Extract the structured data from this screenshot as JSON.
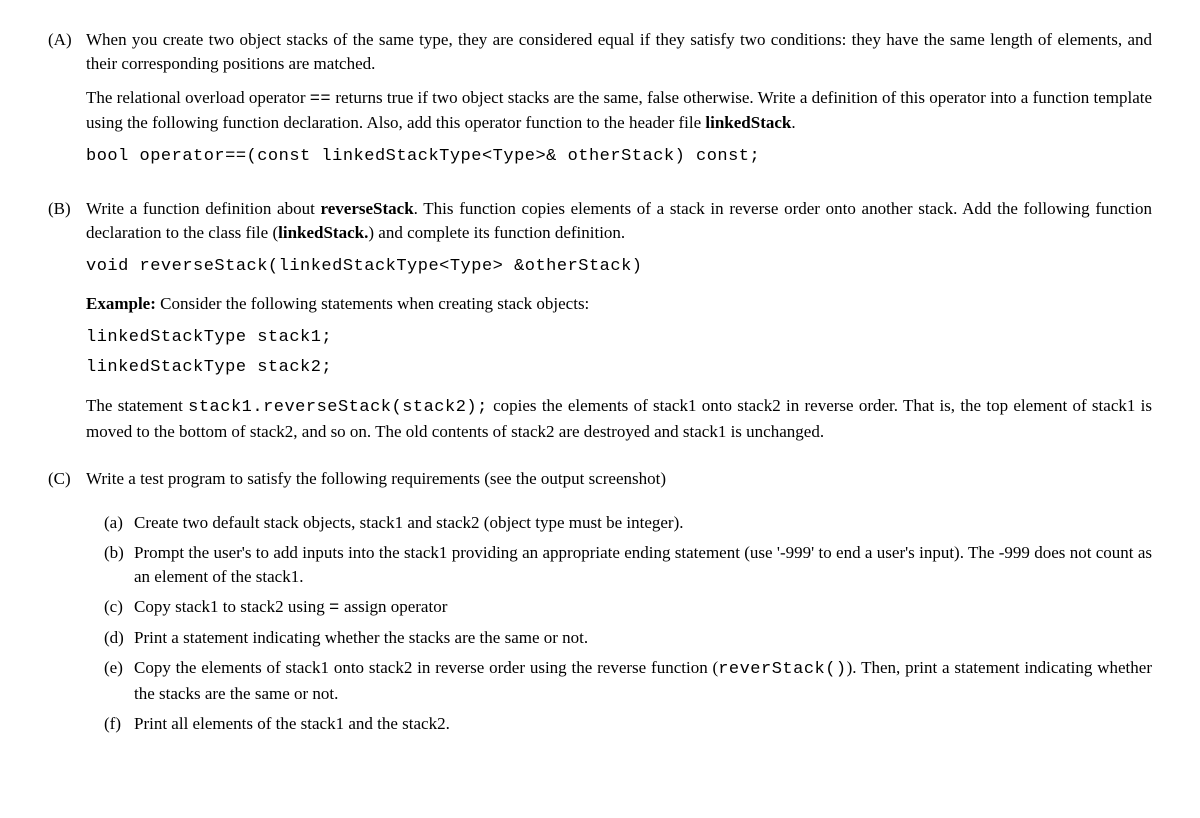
{
  "A": {
    "label": "(A)",
    "p1": "When you create two object stacks of the same type, they are considered equal if they satisfy two conditions: they have the same length of elements, and their corresponding positions are matched.",
    "p2a": "The relational overload operator ",
    "p2op": "==",
    "p2b": " returns true if two object stacks are the same, false otherwise. Write a definition of this operator into a function template using the following function declaration. Also, add this operator function to the header file ",
    "p2bold": "linkedStack",
    "p2c": ".",
    "code": "bool  operator==(const  linkedStackType<Type>&  otherStack)  const;"
  },
  "B": {
    "label": "(B)",
    "p1a": "Write a function definition about ",
    "p1bold": "reverseStack",
    "p1b": ". This function copies elements of a stack in reverse order onto another stack. Add the following function declaration to the class file (",
    "p1bold2": "linkedStack.",
    "p1c": ") and complete its function definition.",
    "code1": "void    reverseStack(linkedStackType<Type> &otherStack)",
    "exLabel": "Example:",
    "exText": " Consider the following statements when creating stack objects:",
    "code2a": "linkedStackType  stack1;",
    "code2b": "linkedStackType  stack2;",
    "p2a": "The statement ",
    "p2code": "stack1.reverseStack(stack2);",
    "p2b": " copies the elements of stack1 onto stack2 in reverse order. That is, the top element of stack1 is moved to the bottom of stack2, and so on. The old contents of stack2 are destroyed and stack1 is unchanged."
  },
  "C": {
    "label": "(C)",
    "p1": "Write a test program to satisfy the following requirements (see the output screenshot)",
    "items": {
      "a": {
        "label": "(a)",
        "text": "Create two default stack objects, stack1 and stack2 (object type must be integer)."
      },
      "b": {
        "label": "(b)",
        "text": "Prompt the user's to add inputs into the stack1 providing an appropriate ending statement (use '-999' to end a user's input). The -999 does not count as an element of the stack1."
      },
      "c": {
        "label": "(c)",
        "textA": "Copy stack1 to stack2 using ",
        "op": "=",
        "textB": " assign operator"
      },
      "d": {
        "label": "(d)",
        "text": "Print a statement indicating whether the stacks are the same or not."
      },
      "e": {
        "label": "(e)",
        "textA": "Copy the elements of stack1 onto stack2 in reverse order using the reverse function (",
        "code": "reverStack()",
        "textB": "). Then, print a statement indicating whether the stacks are the same or not."
      },
      "f": {
        "label": "(f)",
        "text": "Print all elements of the stack1 and the stack2."
      }
    }
  }
}
